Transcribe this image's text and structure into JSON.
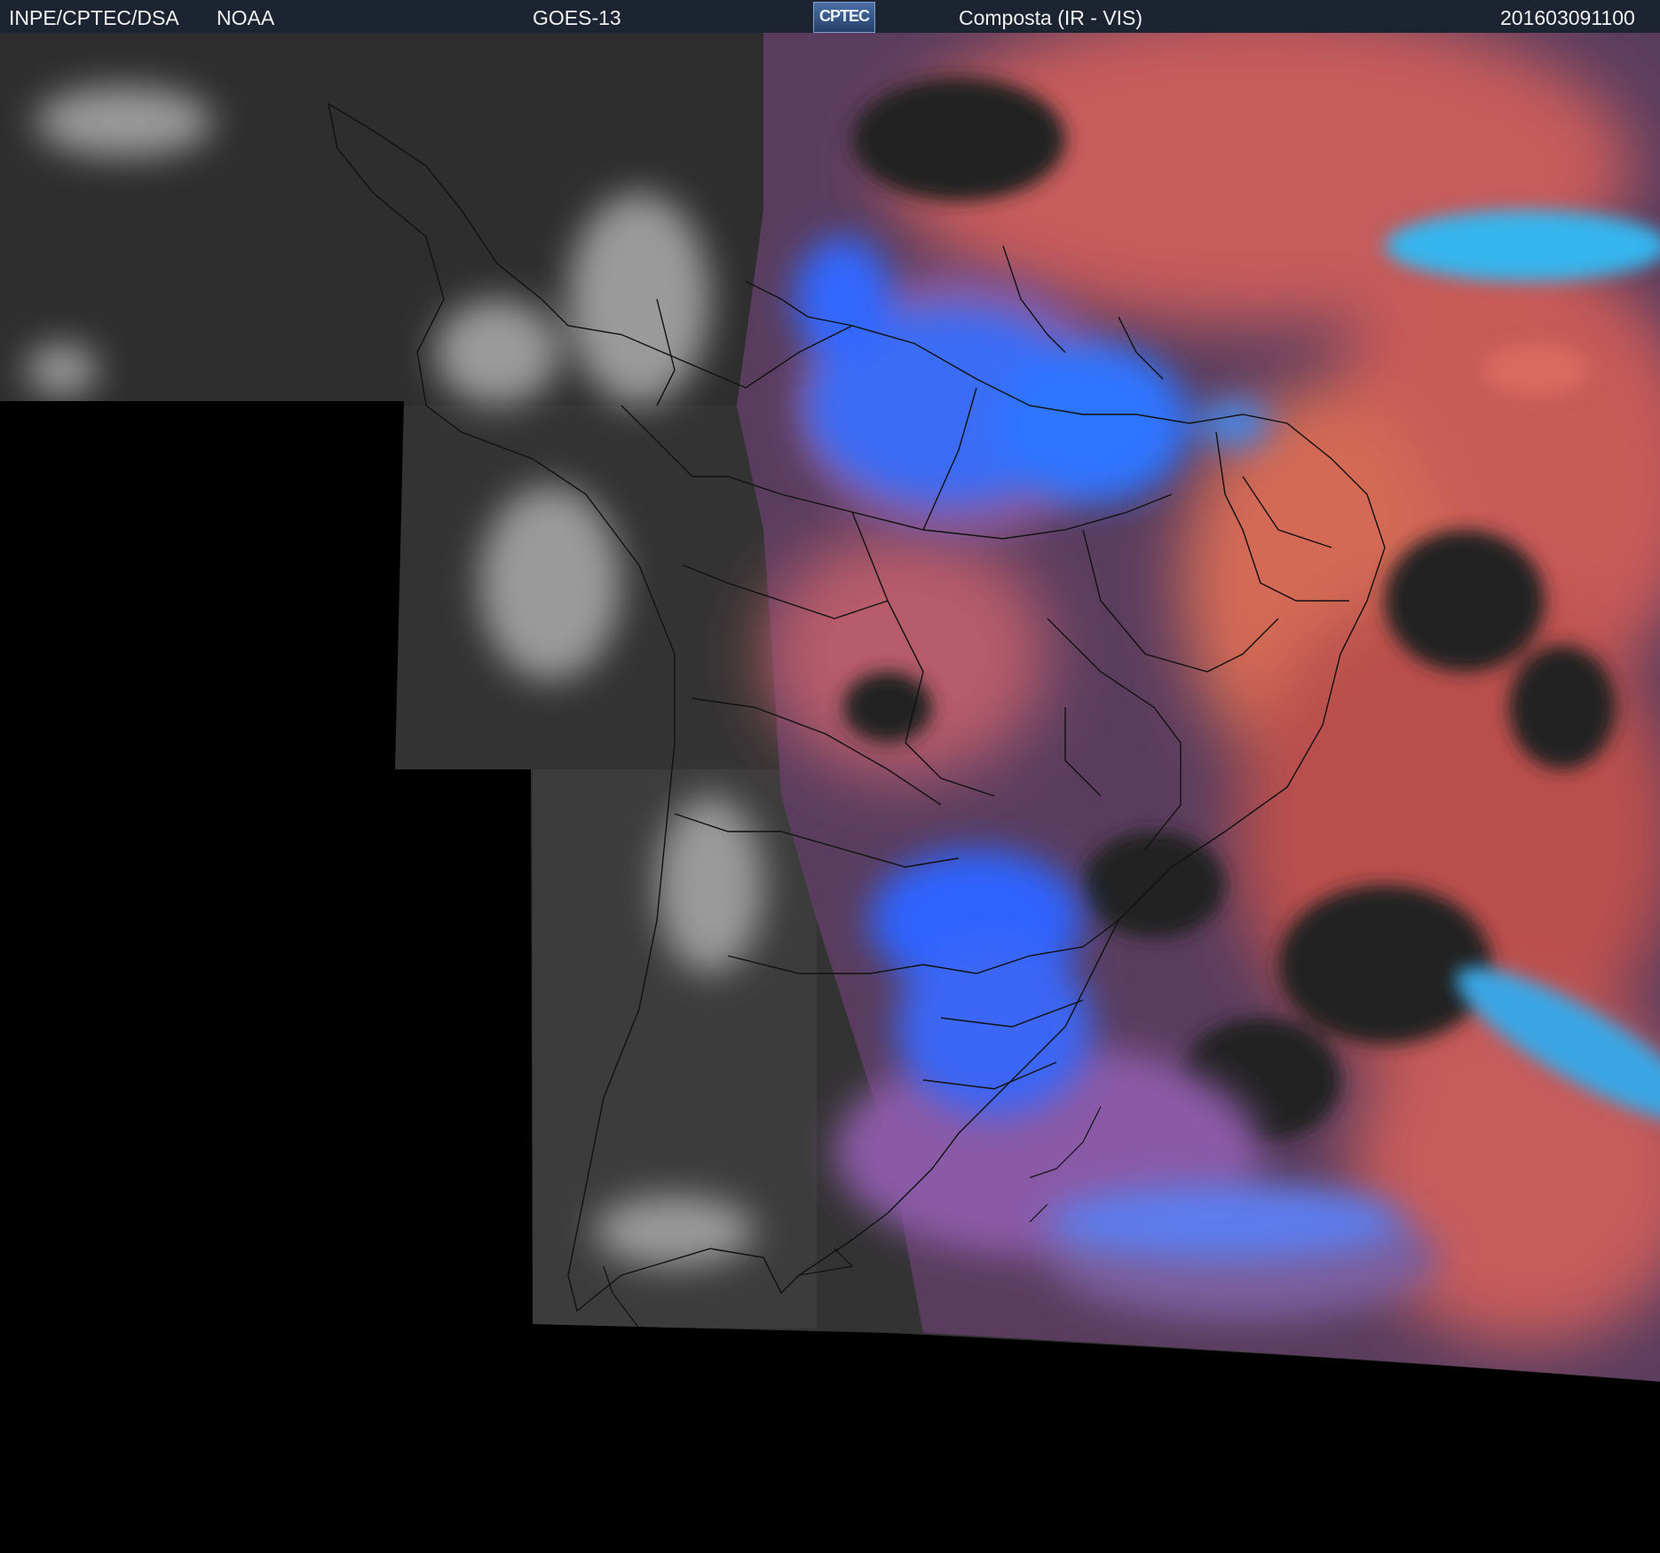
{
  "header": {
    "agency": "INPE/CPTEC/DSA",
    "source": "NOAA",
    "satellite": "GOES-13",
    "logo_text": "CPTEC",
    "product": "Composta (IR - VIS)",
    "timestamp": "201603091100"
  },
  "colors": {
    "header_bg": "#1b2430",
    "background": "#000000",
    "ir_gray": "#3a3a3a",
    "ocean_dark": "#262626",
    "high_cloud_blue": "#2f6cff",
    "low_cloud_red": "#c85a58",
    "mid_purple": "#8a5a9e",
    "cyan": "#38b8f0",
    "orange_red": "#d46a55"
  }
}
